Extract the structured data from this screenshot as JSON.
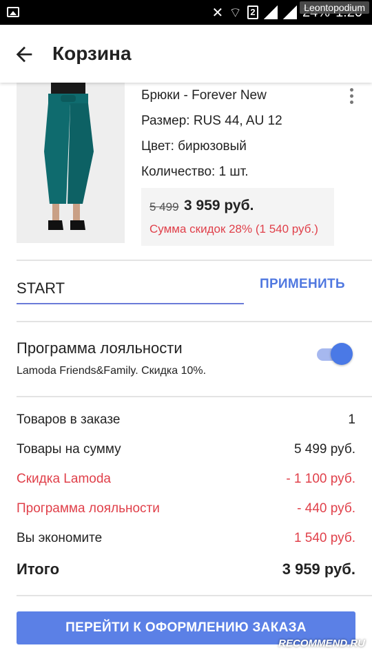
{
  "status_bar": {
    "sim_label": "2",
    "battery": "24%",
    "time": "1:20",
    "watermark": "Leontopodium"
  },
  "appbar": {
    "title": "Корзина",
    "back_icon": "arrow-left-icon"
  },
  "product": {
    "name": "Брюки - Forever New",
    "size": "Размер: RUS 44, AU 12",
    "color": "Цвет: бирюзовый",
    "quantity": "Количество: 1 шт.",
    "old_price": "5 499",
    "new_price": "3 959 руб.",
    "discount": "Сумма скидок 28% (1 540 руб.)",
    "image_color": "#0f6b6e"
  },
  "promo": {
    "value": "START",
    "apply_label": "ПРИМЕНИТЬ"
  },
  "loyalty": {
    "title": "Программа лояльности",
    "subtitle": "Lamoda Friends&Family. Скидка 10%.",
    "enabled": true
  },
  "summary": {
    "rows": [
      {
        "label": "Товаров в заказе",
        "value": "1"
      },
      {
        "label": "Товары на сумму",
        "value": "5 499 руб."
      },
      {
        "label": "Скидка Lamoda",
        "value": "- 1 100 руб."
      },
      {
        "label": "Программа лояльности",
        "value": "- 440 руб."
      },
      {
        "label": "Вы экономите",
        "value": "1 540 руб."
      }
    ],
    "total_label": "Итого",
    "total_value": "3 959 руб."
  },
  "checkout": {
    "label": "ПЕРЕЙТИ К ОФОРМЛЕНИЮ ЗАКАЗА"
  },
  "watermark_bottom": "RECOMMEND.RU",
  "colors": {
    "accent": "#5b80e6",
    "discount_red": "#e0404a"
  }
}
